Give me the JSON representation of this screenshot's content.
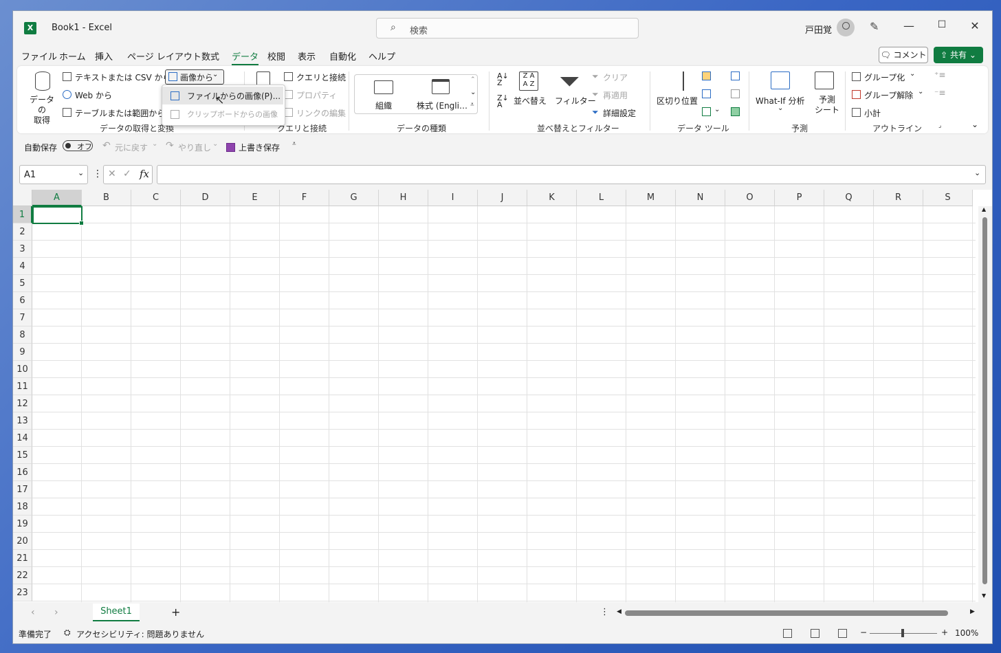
{
  "window": {
    "title": "Book1  -  Excel",
    "app_logo": "X",
    "search_placeholder": "検索",
    "user_name": "戸田覚",
    "controls": {
      "minimize": "—",
      "maximize": "☐",
      "close": "✕"
    }
  },
  "menu_tabs": [
    "ファイル",
    "ホーム",
    "挿入",
    "ページ レイアウト",
    "数式",
    "データ",
    "校閲",
    "表示",
    "自動化",
    "ヘルプ"
  ],
  "active_tab": "データ",
  "header_buttons": {
    "comment": "コメント",
    "share": "共有"
  },
  "ribbon": {
    "get_data": {
      "big_button": "データの\n取得",
      "text_csv": "テキストまたは CSV から",
      "web": "Web から",
      "table_range": "テーブルまたは範囲から",
      "from_picture": "画像から",
      "group_label": "データの取得と変換"
    },
    "queries": {
      "queries_connections": "クエリと接続",
      "properties": "プロパティ",
      "edit_links": "リンクの編集",
      "group_label": "クエリと接続"
    },
    "data_types": {
      "org": "組織",
      "stocks": "株式 (Engli…",
      "group_label": "データの種類"
    },
    "sort_filter": {
      "sort": "並べ替え",
      "filter": "フィルター",
      "clear": "クリア",
      "reapply": "再適用",
      "advanced": "詳細設定",
      "group_label": "並べ替えとフィルター"
    },
    "data_tools": {
      "text_to_columns": "区切り位置",
      "group_label": "データ ツール"
    },
    "forecast": {
      "what_if": "What-If 分析",
      "forecast_sheet": "予測\nシート",
      "group_label": "予測"
    },
    "outline": {
      "group": "グループ化",
      "ungroup": "グループ解除",
      "subtotal": "小計",
      "group_label": "アウトライン"
    }
  },
  "picture_dropdown": {
    "from_file": "ファイルからの画像(P)...",
    "from_clipboard": "クリップボードからの画像"
  },
  "qat": {
    "autosave_label": "自動保存",
    "autosave_state": "オフ",
    "undo": "元に戻す",
    "redo": "やり直し",
    "save": "上書き保存"
  },
  "formula_bar": {
    "name_box": "A1",
    "fx": "fx",
    "formula": ""
  },
  "columns": [
    "A",
    "B",
    "C",
    "D",
    "E",
    "F",
    "G",
    "H",
    "I",
    "J",
    "K",
    "L",
    "M",
    "N",
    "O",
    "P",
    "Q",
    "R",
    "S"
  ],
  "rows": [
    "1",
    "2",
    "3",
    "4",
    "5",
    "6",
    "7",
    "8",
    "9",
    "10",
    "11",
    "12",
    "13",
    "14",
    "15",
    "16",
    "17",
    "18",
    "19",
    "20",
    "21",
    "22",
    "23"
  ],
  "sheet_tabs": [
    "Sheet1"
  ],
  "status": {
    "ready": "準備完了",
    "accessibility": "アクセシビリティ: 問題ありません",
    "zoom": "100%"
  },
  "colors": {
    "accent": "#107c41"
  }
}
